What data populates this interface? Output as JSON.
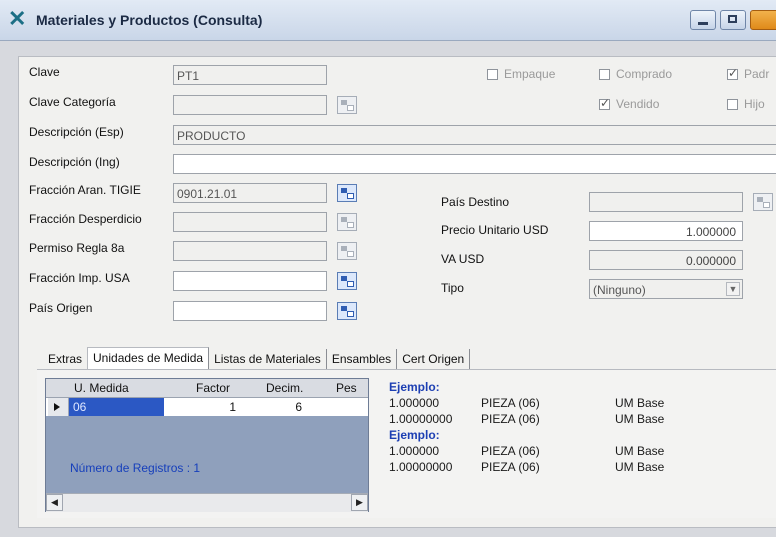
{
  "window": {
    "title": "Materiales y Productos (Consulta)"
  },
  "form": {
    "clave_label": "Clave",
    "clave_value": "PT1",
    "clave_categoria_label": "Clave Categoría",
    "clave_categoria_value": "",
    "descripcion_esp_label": "Descripción (Esp)",
    "descripcion_esp_value": "PRODUCTO",
    "descripcion_ing_label": "Descripción (Ing)",
    "descripcion_ing_value": "",
    "fraccion_aran_label": "Fracción Aran. TIGIE",
    "fraccion_aran_value": "0901.21.01",
    "fraccion_desperdicio_label": "Fracción Desperdicio",
    "fraccion_desperdicio_value": "",
    "permiso_regla_label": "Permiso Regla 8a",
    "permiso_regla_value": "",
    "fraccion_imp_usa_label": "Fracción Imp. USA",
    "fraccion_imp_usa_value": "",
    "pais_origen_label": "País Origen",
    "pais_origen_value": "",
    "pais_destino_label": "País Destino",
    "pais_destino_value": "",
    "precio_unitario_label": "Precio Unitario USD",
    "precio_unitario_value": "1.000000",
    "va_usd_label": "VA USD",
    "va_usd_value": "0.000000",
    "tipo_label": "Tipo",
    "tipo_value": "(Ninguno)"
  },
  "checkboxes": {
    "empaque": {
      "label": "Empaque",
      "checked": false
    },
    "comprado": {
      "label": "Comprado",
      "checked": false
    },
    "padre": {
      "label": "Padr",
      "checked": true
    },
    "vendido": {
      "label": "Vendido",
      "checked": true
    },
    "hijo": {
      "label": "Hijo",
      "checked": false
    }
  },
  "tabs": [
    {
      "label": "Extras",
      "active": false
    },
    {
      "label": "Unidades de Medida",
      "active": true
    },
    {
      "label": "Listas de Materiales",
      "active": false
    },
    {
      "label": "Ensambles",
      "active": false
    },
    {
      "label": "Cert Origen",
      "active": false
    }
  ],
  "grid": {
    "headers": [
      "U. Medida",
      "Factor",
      "Decim.",
      "Pes"
    ],
    "rows": [
      {
        "umedida": "06",
        "factor": "1",
        "decim": "6"
      }
    ],
    "record_count": "Número de Registros : 1"
  },
  "example": {
    "title1": "Ejemplo:",
    "rows1": [
      {
        "value": "1.000000",
        "unit": "PIEZA  (06)",
        "tag": "UM Base"
      },
      {
        "value": "1.00000000",
        "unit": "PIEZA  (06)",
        "tag": "UM Base"
      }
    ],
    "title2": "Ejemplo:",
    "rows2": [
      {
        "value": "1.000000",
        "unit": "PIEZA  (06)",
        "tag": "UM Base"
      },
      {
        "value": "1.00000000",
        "unit": "PIEZA  (06)",
        "tag": "UM Base"
      }
    ]
  },
  "icons": {
    "app": "app-logo-icon",
    "lookup": "lookup-icon",
    "minimize": "minimize-icon",
    "maximize": "maximize-icon"
  }
}
